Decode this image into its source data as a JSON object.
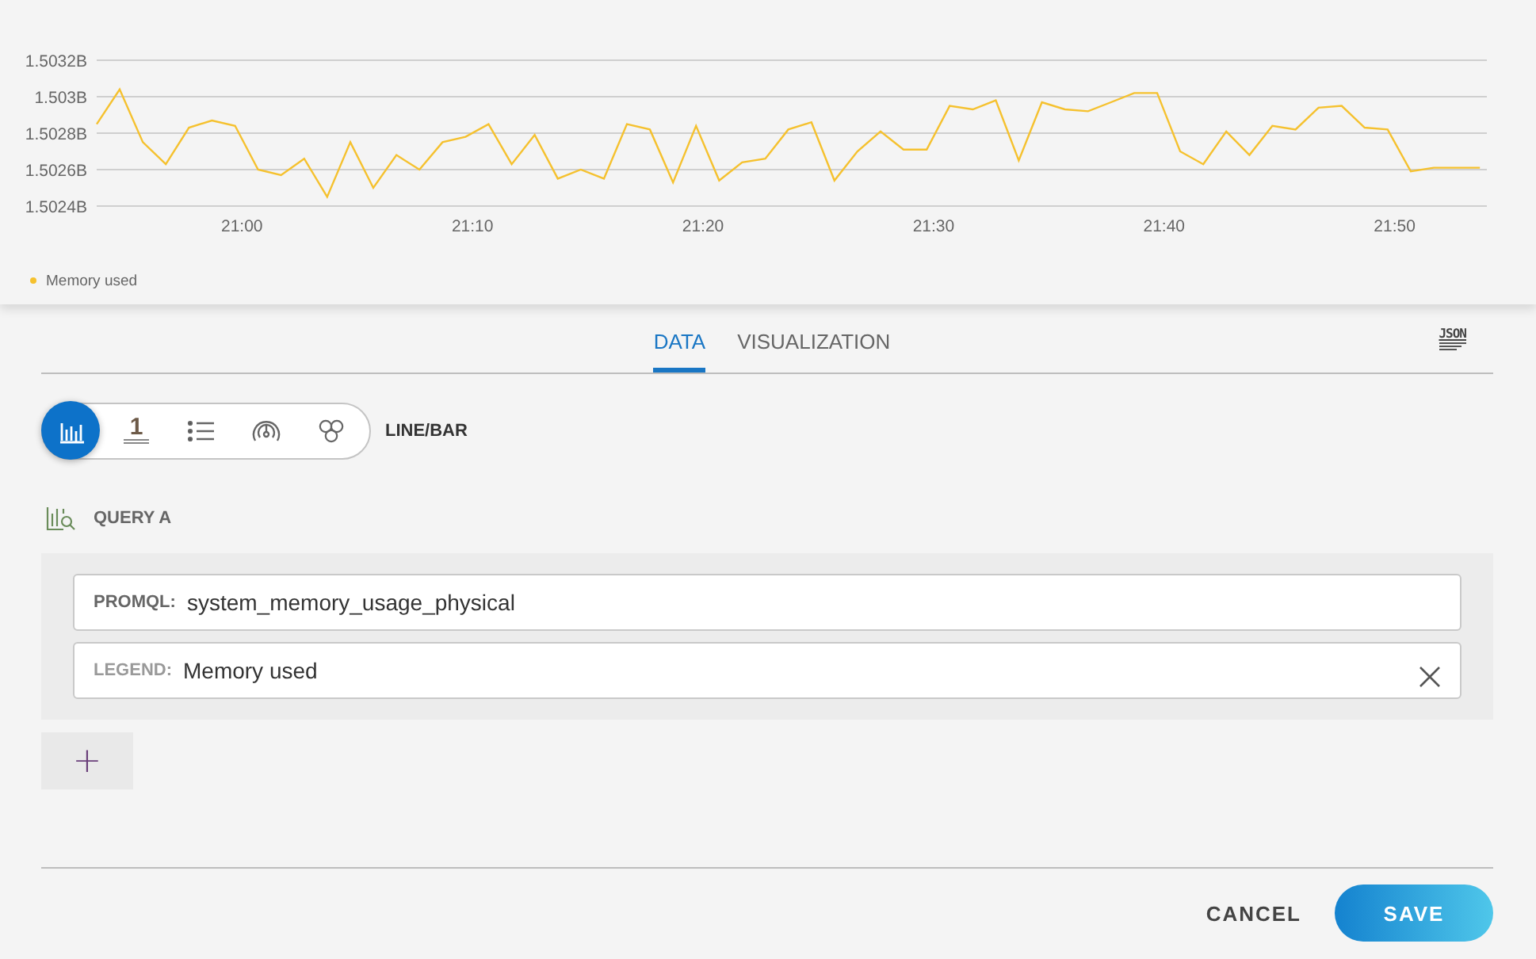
{
  "chart": {
    "chart_data": {
      "type": "line",
      "categories": [
        null,
        null,
        null,
        null,
        null,
        null,
        "21:00",
        null,
        null,
        null,
        null,
        null,
        null,
        null,
        null,
        null,
        "21:10",
        null,
        null,
        null,
        null,
        null,
        null,
        null,
        null,
        null,
        "21:20",
        null,
        null,
        null,
        null,
        null,
        null,
        null,
        null,
        null,
        "21:30",
        null,
        null,
        null,
        null,
        null,
        null,
        null,
        null,
        null,
        "21:40",
        null,
        null,
        null,
        null,
        null,
        null,
        null,
        null,
        null,
        "21:50",
        null,
        null,
        null,
        null
      ],
      "series": [
        {
          "name": "Memory used",
          "color": "#f5c12e",
          "values": [
            1.50285,
            1.50304,
            1.50275,
            1.50263,
            1.50283,
            1.50287,
            1.50284,
            1.5026,
            1.50257,
            1.50266,
            1.50245,
            1.50275,
            1.5025,
            1.50268,
            1.5026,
            1.50275,
            1.50278,
            1.50285,
            1.50263,
            1.50279,
            1.50255,
            1.5026,
            1.50255,
            1.50285,
            1.50282,
            1.50253,
            1.50284,
            1.50254,
            1.50264,
            1.50266,
            1.50282,
            1.50286,
            1.50254,
            1.5027,
            1.50281,
            1.50271,
            1.50271,
            1.50295,
            1.50293,
            1.50298,
            1.50265,
            1.50297,
            1.50293,
            1.50292,
            1.50297,
            1.50302,
            1.50302,
            1.5027,
            1.50263,
            1.50281,
            1.50268,
            1.50284,
            1.50282,
            1.50294,
            1.50295,
            1.50283,
            1.50282,
            1.50259,
            1.50261,
            1.50261,
            1.50261
          ]
        }
      ],
      "ylim": [
        1.5024,
        1.5032
      ],
      "grid": true,
      "yticks": [
        {
          "value": 1.5024,
          "label": "1.5024B"
        },
        {
          "value": 1.5026,
          "label": "1.5026B"
        },
        {
          "value": 1.5028,
          "label": "1.5028B"
        },
        {
          "value": 1.503,
          "label": "1.503B"
        },
        {
          "value": 1.5032,
          "label": "1.5032B"
        }
      ]
    }
  },
  "tabs": [
    {
      "label": "DATA",
      "selected": true
    },
    {
      "label": "VISUALIZATION",
      "selected": false
    }
  ],
  "json_button": {
    "label": "JSON"
  },
  "viz_types": [
    {
      "kind": "linebar",
      "selected": true
    },
    {
      "kind": "single",
      "label": "1",
      "selected": false
    },
    {
      "kind": "list",
      "selected": false
    },
    {
      "kind": "gauge",
      "selected": false
    },
    {
      "kind": "hexagon",
      "selected": false
    }
  ],
  "viz_label": "LINE/BAR",
  "query": {
    "title": "QUERY A",
    "fields": [
      {
        "label": "PROMQL:",
        "value": "system_memory_usage_physical",
        "clearable": false
      },
      {
        "label": "LEGEND:",
        "value": "Memory used",
        "clearable": true
      }
    ]
  },
  "add_button": {
    "label": "+"
  },
  "footer": {
    "cancel": "CANCEL",
    "save": "SAVE"
  }
}
